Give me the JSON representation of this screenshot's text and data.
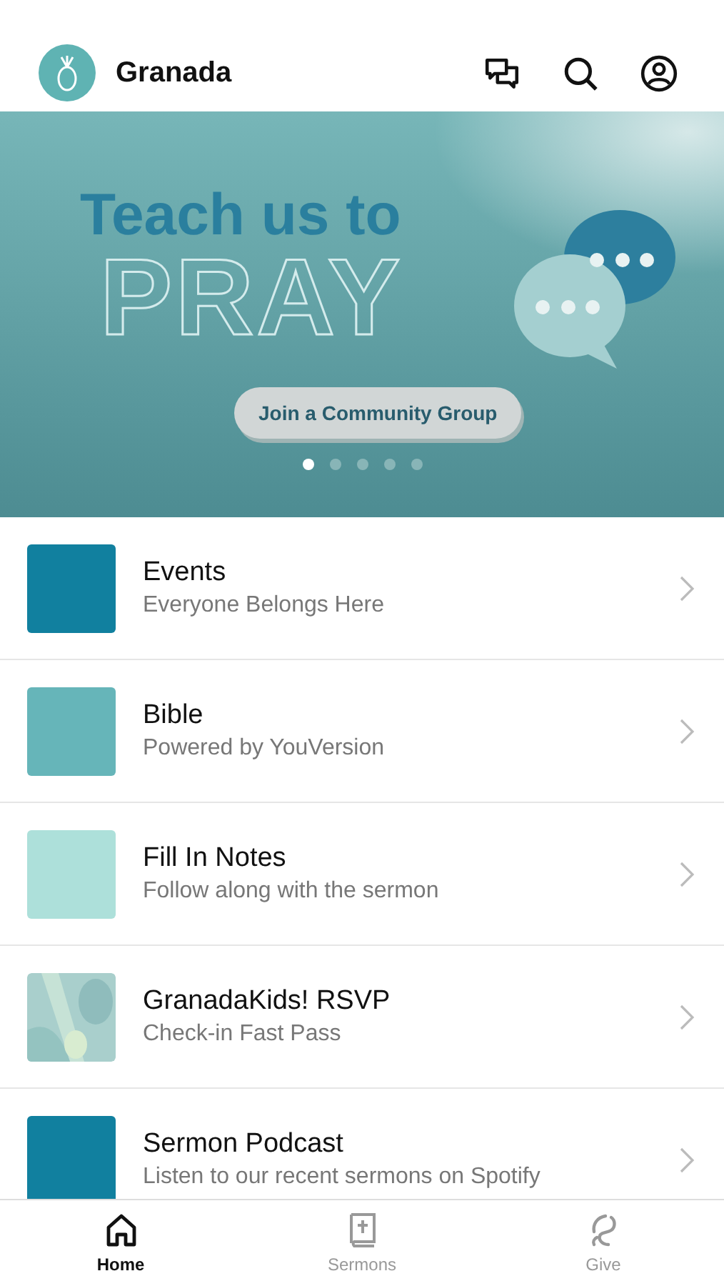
{
  "header": {
    "title": "Granada"
  },
  "banner": {
    "headline": "Teach us to",
    "headline_outline": "PRAY",
    "button": "Join a Community Group",
    "dots": [
      {
        "selected": true
      },
      {
        "selected": false
      },
      {
        "selected": false
      },
      {
        "selected": false
      },
      {
        "selected": false
      }
    ]
  },
  "items": [
    {
      "kind": "swatch",
      "color": "#11809f",
      "title": "Events",
      "subtitle": "Everyone Belongs Here"
    },
    {
      "kind": "swatch",
      "color": "#66b5b9",
      "title": "Bible",
      "subtitle": "Powered by YouVersion"
    },
    {
      "kind": "swatch",
      "color": "#ade0da",
      "title": "Fill In Notes",
      "subtitle": "Follow along with the sermon"
    },
    {
      "kind": "picture",
      "title": "GranadaKids! RSVP",
      "subtitle": "Check-in Fast Pass"
    },
    {
      "kind": "swatch",
      "color": "#11809f",
      "title": "Sermon Podcast",
      "subtitle": "Listen to our recent sermons on Spotify"
    }
  ],
  "tabs": [
    {
      "label": "Home",
      "kind": "home",
      "selected": true
    },
    {
      "label": "Sermons",
      "kind": "bible",
      "selected": false
    },
    {
      "label": "Give",
      "kind": "give",
      "selected": false
    }
  ]
}
